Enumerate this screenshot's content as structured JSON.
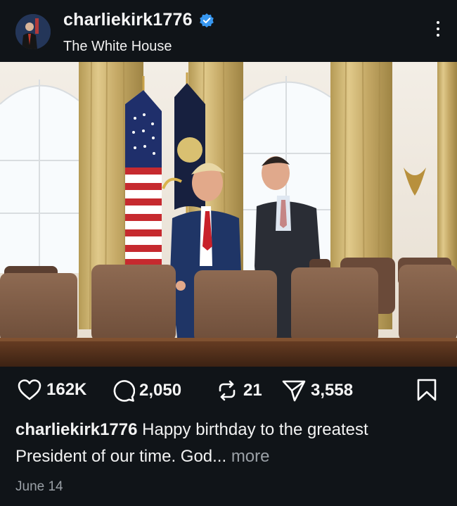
{
  "post": {
    "username": "charliekirk1776",
    "location": "The White House",
    "likes": "162K",
    "comments": "2,050",
    "reposts": "21",
    "shares": "3,558",
    "caption_text": "Happy birthday to the greatest President of our time. God...",
    "more_label": "more",
    "date": "June 14"
  },
  "icons": {
    "verified": "verified-badge-icon",
    "menu": "more-options-icon",
    "like": "heart-icon",
    "comment": "comment-icon",
    "repost": "repost-icon",
    "share": "send-icon",
    "bookmark": "bookmark-icon"
  },
  "colors": {
    "background": "#101418",
    "verified": "#3797f0",
    "muted_text": "#9aa0a6"
  }
}
